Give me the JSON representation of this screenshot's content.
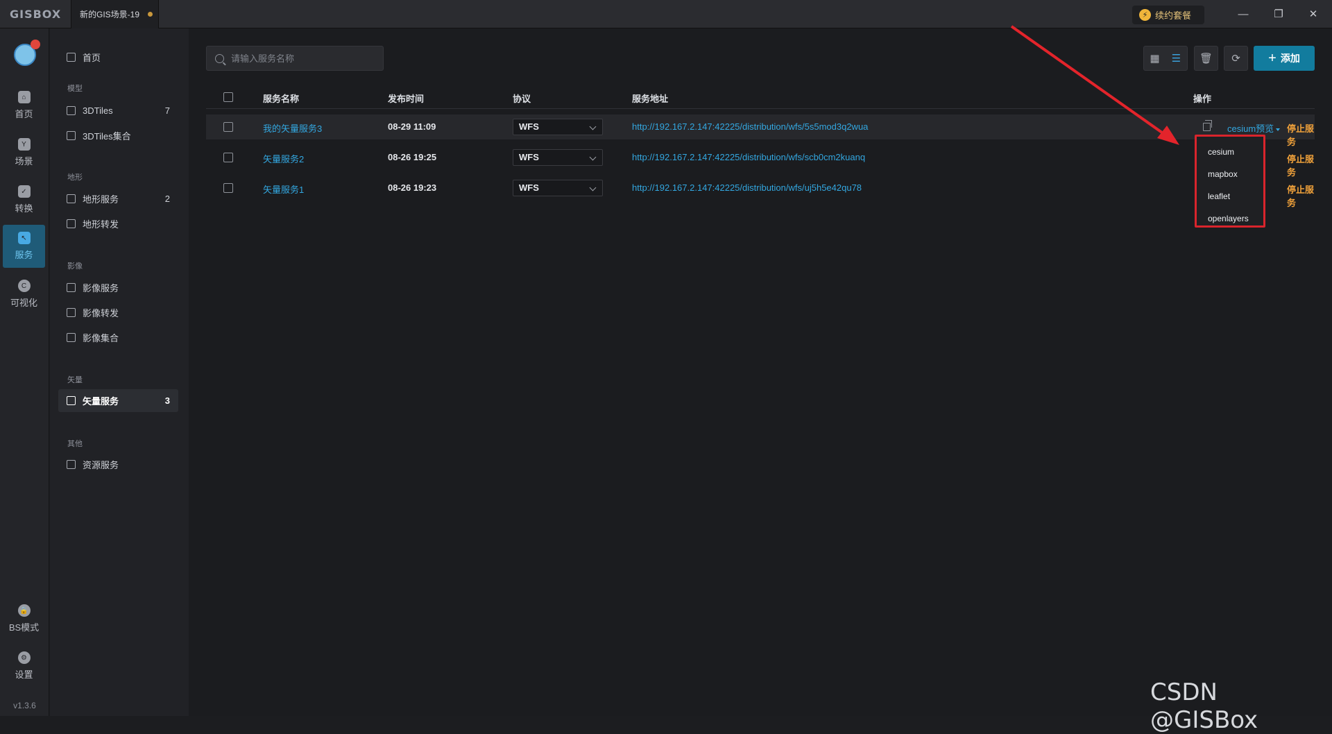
{
  "app": {
    "logo": "GISBOX",
    "tab_title": "新的GIS场景-19",
    "renew_label": "续约套餐",
    "version": "v1.3.6",
    "accent_color": "#127c9e",
    "link_color": "#33a7e0",
    "stop_color": "#f0a13a"
  },
  "rail": {
    "items": [
      {
        "label": "首页",
        "icon": "home-icon"
      },
      {
        "label": "场景",
        "icon": "scene-icon"
      },
      {
        "label": "转换",
        "icon": "convert-icon"
      },
      {
        "label": "服务",
        "icon": "service-icon",
        "active": true
      },
      {
        "label": "可视化",
        "icon": "visualize-icon"
      }
    ],
    "bottom": [
      {
        "label": "BS模式",
        "icon": "lock-icon"
      },
      {
        "label": "设置",
        "icon": "gear-icon"
      }
    ]
  },
  "sidebar": {
    "home": "首页",
    "groups": {
      "model": "模型",
      "terrain": "地形",
      "imagery": "影像",
      "vector": "矢量",
      "other": "其他"
    },
    "items": {
      "tiles": {
        "label": "3DTiles",
        "count": "7"
      },
      "tileset": {
        "label": "3DTiles集合"
      },
      "terrain_service": {
        "label": "地形服务",
        "count": "2"
      },
      "terrain_forward": {
        "label": "地形转发"
      },
      "imagery_service": {
        "label": "影像服务"
      },
      "imagery_forward": {
        "label": "影像转发"
      },
      "imagery_set": {
        "label": "影像集合"
      },
      "vector_service": {
        "label": "矢量服务",
        "count": "3"
      },
      "resource_service": {
        "label": "资源服务"
      }
    }
  },
  "toolbar": {
    "search_placeholder": "请输入服务名称",
    "add_label": "添加"
  },
  "table": {
    "headers": {
      "name": "服务名称",
      "time": "发布时间",
      "protocol": "协议",
      "url": "服务地址",
      "ops": "操作"
    },
    "rows": [
      {
        "name": "我的矢量服务3",
        "time": "08-29 11:09",
        "protocol": "WFS",
        "url": "http://192.167.2.147:42225/distribution/wfs/5s5mod3q2wua",
        "preview": "cesium预览",
        "stop": "停止服务"
      },
      {
        "name": "矢量服务2",
        "time": "08-26 19:25",
        "protocol": "WFS",
        "url": "http://192.167.2.147:42225/distribution/wfs/scb0cm2kuanq",
        "stop": "停止服务"
      },
      {
        "name": "矢量服务1",
        "time": "08-26 19:23",
        "protocol": "WFS",
        "url": "http://192.167.2.147:42225/distribution/wfs/uj5h5e42qu78",
        "stop": "停止服务"
      }
    ]
  },
  "preview_menu": {
    "options": [
      "cesium",
      "mapbox",
      "leaflet",
      "openlayers"
    ]
  },
  "watermark": "CSDN @GISBox"
}
